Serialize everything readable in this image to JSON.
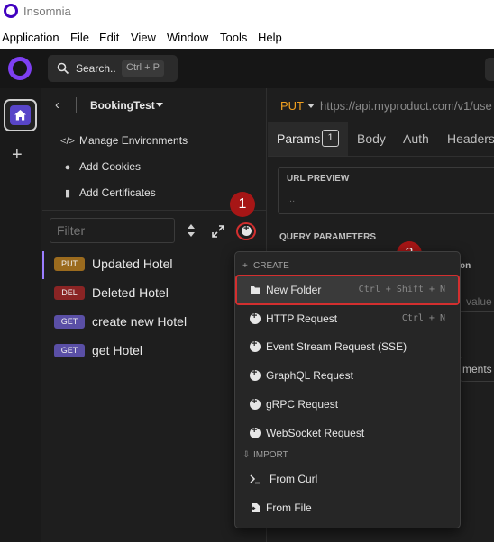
{
  "window": {
    "title": "Insomnia"
  },
  "menubar": [
    "Application",
    "File",
    "Edit",
    "View",
    "Window",
    "Tools",
    "Help"
  ],
  "topbar": {
    "search_label": "Search..",
    "search_shortcut": "Ctrl + P"
  },
  "sidebar": {
    "project": "BookingTest",
    "actions": [
      {
        "label": "Manage Environments",
        "icon": "code-icon"
      },
      {
        "label": "Add Cookies",
        "icon": "cookie-icon"
      },
      {
        "label": "Add Certificates",
        "icon": "certificate-icon"
      }
    ],
    "filter_placeholder": "Filter",
    "requests": [
      {
        "method": "PUT",
        "name": "Updated Hotel",
        "color": "#9b6b1e"
      },
      {
        "method": "DEL",
        "name": "Deleted Hotel",
        "color": "#8a2424"
      },
      {
        "method": "GET",
        "name": "create new Hotel",
        "color": "#5a4fa6"
      },
      {
        "method": "GET",
        "name": "get Hotel",
        "color": "#5a4fa6"
      }
    ]
  },
  "request": {
    "method": "PUT",
    "url": "https://api.myproduct.com/v1/use",
    "tabs": [
      "Params",
      "Body",
      "Auth",
      "Headers"
    ],
    "params_count": "1",
    "url_preview_title": "URL PREVIEW",
    "url_preview_value": "...",
    "query_params_title": "QUERY PARAMETERS",
    "partial_header": "on",
    "partial_value": "value",
    "partial_button": "ments to"
  },
  "markers": [
    "1",
    "2"
  ],
  "create_menu": {
    "create_section": "CREATE",
    "items": [
      {
        "label": "New Folder",
        "shortcut": "Ctrl + Shift + N",
        "icon": "folder-icon"
      },
      {
        "label": "HTTP Request",
        "shortcut": "Ctrl + N",
        "icon": "plus-circle-icon"
      },
      {
        "label": "Event Stream Request (SSE)",
        "shortcut": "",
        "icon": "plus-circle-icon"
      },
      {
        "label": "GraphQL Request",
        "shortcut": "",
        "icon": "plus-circle-icon"
      },
      {
        "label": "gRPC Request",
        "shortcut": "",
        "icon": "plus-circle-icon"
      },
      {
        "label": "WebSocket Request",
        "shortcut": "",
        "icon": "plus-circle-icon"
      }
    ],
    "import_section": "IMPORT",
    "import_items": [
      {
        "label": "From Curl",
        "icon": "terminal-icon"
      },
      {
        "label": "From File",
        "icon": "file-import-icon"
      }
    ]
  },
  "colors": {
    "accent": "#7e3ff2",
    "highlight": "#d32f2f",
    "put": "#f0a020"
  }
}
